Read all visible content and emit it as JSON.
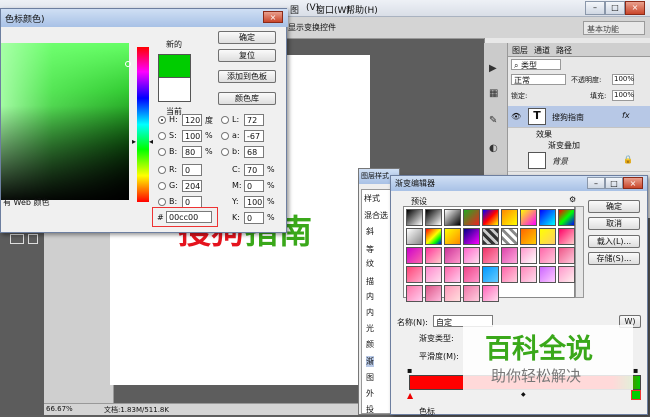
{
  "menubar": {
    "items": [
      "图",
      "(V)",
      "窗口(W)",
      "帮助(H)"
    ]
  },
  "optbar": {
    "label": "显示变换控件"
  },
  "workspace": {
    "value": "基本功能"
  },
  "color_picker": {
    "title": "色标颜色)",
    "new_label": "新的",
    "current_label": "当前",
    "buttons": {
      "ok": "确定",
      "reset": "复位",
      "add_swatch": "添加到色板",
      "library": "颜色库"
    },
    "only_web": "有 Web 颜色",
    "hsb": {
      "h": "120",
      "s": "100",
      "b": "80",
      "h_unit": "度",
      "pct": "%"
    },
    "rgb": {
      "r": "0",
      "g": "204",
      "b": "0"
    },
    "lab": {
      "l": "72",
      "a": "-67",
      "b": "68"
    },
    "cmyk": {
      "c": "70",
      "m": "0",
      "y": "100",
      "k": "0"
    },
    "hex": "00cc00",
    "labels": {
      "H": "H:",
      "S": "S:",
      "B": "B:",
      "R": "R:",
      "G": "G:",
      "Bb": "B:",
      "L": "L:",
      "a": "a:",
      "b": "b:",
      "C": "C:",
      "M": "M:",
      "Y": "Y:",
      "K": "K:",
      "hash": "#"
    },
    "new_color": "#00cc00",
    "current_color": "#ffffff"
  },
  "layers_panel": {
    "tabs": [
      "图层",
      "通道",
      "路径"
    ],
    "kind": "类型",
    "blend": "正常",
    "opacity_label": "不透明度:",
    "opacity": "100%",
    "lock_label": "锁定:",
    "fill_label": "填充:",
    "fill": "100%",
    "rows": [
      {
        "name": "搜狗指南",
        "fx": "fx"
      },
      {
        "name": "效果"
      },
      {
        "name": "渐变叠加"
      },
      {
        "name": "背景"
      }
    ]
  },
  "layer_style": {
    "title": "图层样式",
    "items": [
      "样式",
      "混合选",
      "斜",
      "等",
      "纹",
      "描",
      "内",
      "内",
      "光",
      "颜",
      "渐",
      "图",
      "外",
      "投"
    ]
  },
  "gradient_editor": {
    "title": "渐变编辑器",
    "presets_label": "预设",
    "buttons": {
      "ok": "确定",
      "cancel": "取消",
      "load": "载入(L)...",
      "save": "存储(S)..."
    },
    "name_label": "名称(N):",
    "name_value": "自定",
    "new_button": "W)",
    "type_label": "渐变类型:",
    "smooth_label": "平滑度(M):",
    "stops_label": "色标"
  },
  "canvas_text": {
    "red": "搜狗",
    "green": "指南"
  },
  "status": {
    "zoom": "66.67%",
    "doc": "文档:1.83M/511.8K"
  },
  "watermark": {
    "main": "百科全说",
    "sub": "助你轻松解决"
  },
  "colors": {
    "accent": "#00cc00",
    "red": "#e5131d",
    "green": "#3aa81a"
  }
}
